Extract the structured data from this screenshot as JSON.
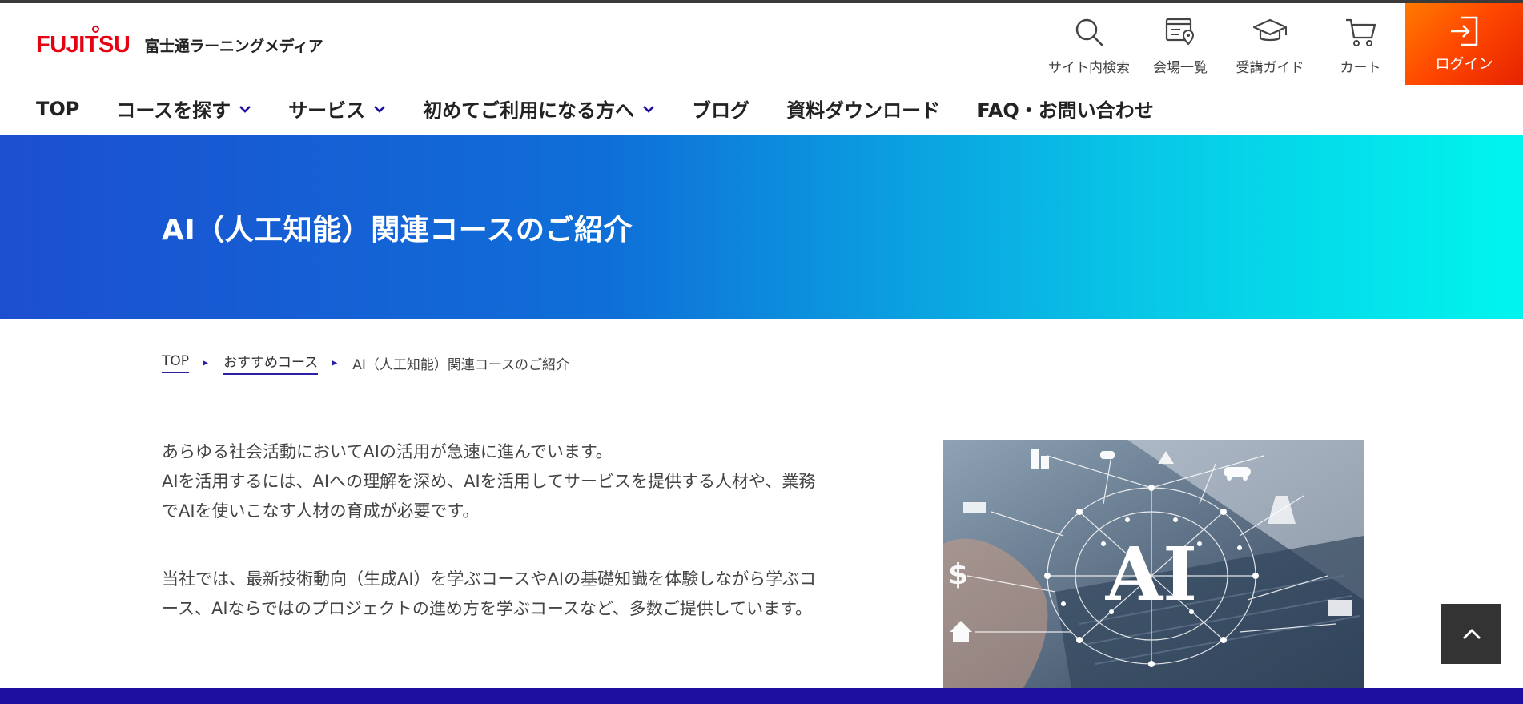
{
  "brand": {
    "logo_text": "FUJITSU",
    "company_name": "富士通ラーニングメディア",
    "logo_color": "#e60012"
  },
  "utility_nav": [
    {
      "label": "サイト内検索",
      "icon": "search-icon"
    },
    {
      "label": "会場一覧",
      "icon": "venue-map-icon"
    },
    {
      "label": "受講ガイド",
      "icon": "graduation-cap-icon"
    },
    {
      "label": "カート",
      "icon": "cart-icon"
    }
  ],
  "login": {
    "label": "ログイン",
    "icon": "login-arrow-icon"
  },
  "main_nav": [
    {
      "label": "TOP",
      "dropdown": false
    },
    {
      "label": "コースを探す",
      "dropdown": true
    },
    {
      "label": "サービス",
      "dropdown": true
    },
    {
      "label": "初めてご利用になる方へ",
      "dropdown": true
    },
    {
      "label": "ブログ",
      "dropdown": false
    },
    {
      "label": "資料ダウンロード",
      "dropdown": false
    },
    {
      "label": "FAQ・お問い合わせ",
      "dropdown": false
    }
  ],
  "hero": {
    "title": "AI（人工知能）関連コースのご紹介"
  },
  "breadcrumb": {
    "items": [
      "TOP",
      "おすすめコース"
    ],
    "current": "AI（人工知能）関連コースのご紹介"
  },
  "content": {
    "paragraph1": [
      "あらゆる社会活動においてAIの活用が急速に進んでいます。",
      "AIを活用するには、AIへの理解を深め、AIを活用してサービスを提供する人材や、業務",
      "でAIを使いこなす人材の育成が必要です。"
    ],
    "paragraph2": [
      "当社では、最新技術動向（生成AI）を学ぶコースやAIの基礎知識を体験しながら学ぶコ",
      "ース、AIならではのプロジェクトの進め方を学ぶコースなど、多数ご提供しています。"
    ],
    "image_text": "AI"
  },
  "colors": {
    "accent": "#1e0fa0",
    "login_gradient_start": "#ff7a00",
    "login_gradient_end": "#e62200",
    "hero_gradient_start": "#1c4fd0",
    "hero_gradient_end": "#00f5ee"
  }
}
